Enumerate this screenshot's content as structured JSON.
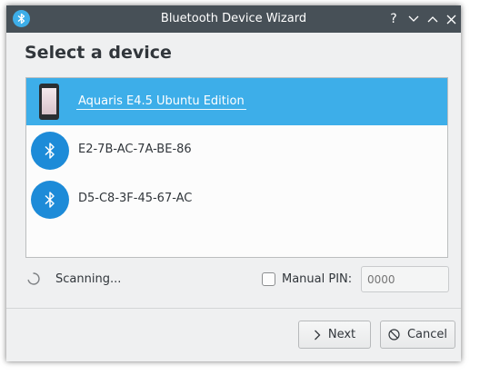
{
  "window": {
    "title": "Bluetooth Device Wizard"
  },
  "titlebar_buttons": [
    {
      "name": "help",
      "glyph": "?"
    },
    {
      "name": "minimize",
      "glyph": "chevron-down"
    },
    {
      "name": "maximize",
      "glyph": "chevron-up"
    },
    {
      "name": "close",
      "glyph": "close"
    }
  ],
  "page": {
    "heading": "Select a device"
  },
  "devices": [
    {
      "label": "Aquaris E4.5 Ubuntu Edition",
      "icon": "phone-icon",
      "selected": true
    },
    {
      "label": "E2-7B-AC-7A-BE-86",
      "icon": "bluetooth-icon",
      "selected": false
    },
    {
      "label": "D5-C8-3F-45-67-AC",
      "icon": "bluetooth-icon",
      "selected": false
    }
  ],
  "status": {
    "scanning_text": "Scanning..."
  },
  "pin": {
    "label": "Manual PIN:",
    "placeholder": "0000",
    "value": "",
    "checked": false
  },
  "buttons": {
    "next_label": "Next",
    "cancel_label": "Cancel"
  },
  "colors": {
    "accent": "#3daee9",
    "titlebar": "#475057",
    "bluetooth": "#1d8bd8"
  }
}
